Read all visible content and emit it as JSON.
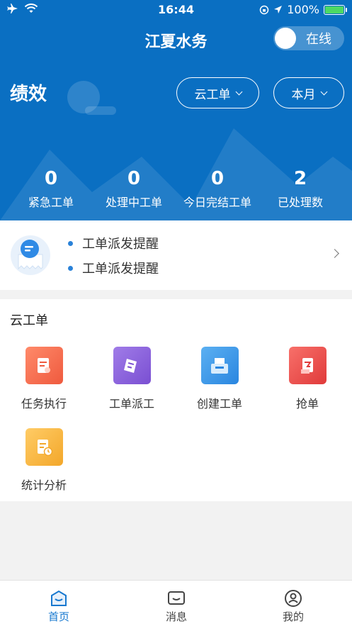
{
  "status_bar": {
    "time": "16:44",
    "battery": "100%",
    "battery_level": 1.0
  },
  "header": {
    "title": "江夏水务",
    "online_label": "在线"
  },
  "performance": {
    "title": "绩效",
    "type_select": "云工单",
    "period_select": "本月",
    "stats": [
      {
        "value": "0",
        "label": "紧急工单"
      },
      {
        "value": "0",
        "label": "处理中工单"
      },
      {
        "value": "0",
        "label": "今日完结工单"
      },
      {
        "value": "2",
        "label": "已处理数"
      }
    ]
  },
  "reminders": {
    "items": [
      "工单派发提醒",
      "工单派发提醒"
    ]
  },
  "cloud_orders": {
    "title": "云工单",
    "tiles": [
      {
        "label": "任务执行",
        "icon": "task-execute-icon",
        "color": "#f36d52"
      },
      {
        "label": "工单派工",
        "icon": "order-dispatch-icon",
        "color": "#8b63d9"
      },
      {
        "label": "创建工单",
        "icon": "create-order-icon",
        "color": "#3a9ae8"
      },
      {
        "label": "抢单",
        "icon": "grab-order-icon",
        "color": "#ec4a4a"
      },
      {
        "label": "统计分析",
        "icon": "statistics-icon",
        "color": "#f5b53a"
      }
    ]
  },
  "tabbar": {
    "tabs": [
      {
        "label": "首页",
        "icon": "home-icon",
        "active": true
      },
      {
        "label": "消息",
        "icon": "message-icon",
        "active": false
      },
      {
        "label": "我的",
        "icon": "profile-icon",
        "active": false
      }
    ]
  },
  "colors": {
    "primary": "#0a6fc2",
    "accent": "#1778cf",
    "background": "#f2f2f2"
  }
}
